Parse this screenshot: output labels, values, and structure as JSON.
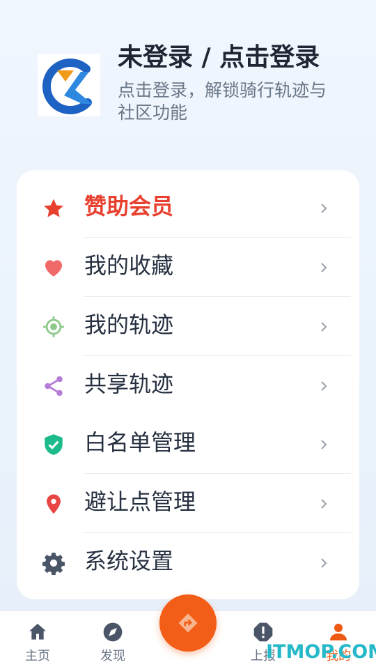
{
  "header": {
    "title": "未登录 / 点击登录",
    "subtitle": "点击登录，解锁骑行轨迹与社区功能"
  },
  "menu": [
    {
      "label": "赞助会员",
      "icon": "star-icon",
      "color": "#e8402f"
    },
    {
      "label": "我的收藏",
      "icon": "heart-icon",
      "color": "#f06a6a"
    },
    {
      "label": "我的轨迹",
      "icon": "locate-icon",
      "color": "#8dc98b"
    },
    {
      "label": "共享轨迹",
      "icon": "share-icon",
      "color": "#b57bd6"
    },
    {
      "label": "白名单管理",
      "icon": "shield-check-icon",
      "color": "#1dbb8b"
    },
    {
      "label": "避让点管理",
      "icon": "map-pin-icon",
      "color": "#e84545"
    },
    {
      "label": "系统设置",
      "icon": "gear-icon",
      "color": "#4b5568"
    }
  ],
  "tabbar": {
    "tabs": [
      {
        "label": "主页",
        "icon": "home-icon",
        "active": false
      },
      {
        "label": "发现",
        "icon": "compass-icon",
        "active": false
      },
      {
        "label": "上报",
        "icon": "alert-icon",
        "active": false
      },
      {
        "label": "我的",
        "icon": "user-icon",
        "active": true
      }
    ],
    "fab_icon": "navigate-icon",
    "accent": "#f25e17"
  },
  "watermark": "ITMOP.COM"
}
